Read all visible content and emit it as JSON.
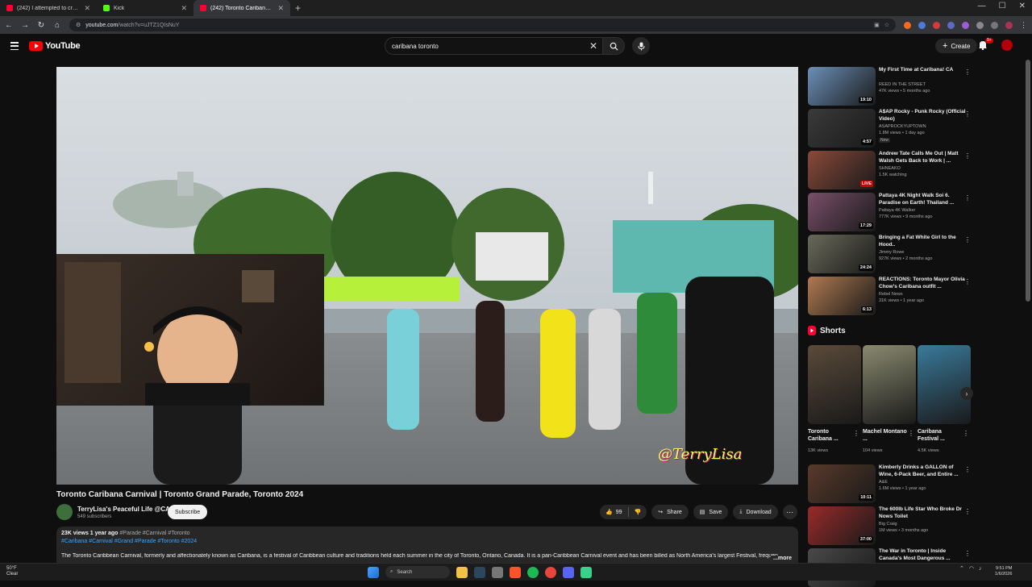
{
  "browser": {
    "tabs": [
      {
        "label": "(242) I attempted to cross Engl",
        "favicon_color": "#ff0033"
      },
      {
        "label": "Kick",
        "favicon_color": "#53fc18"
      },
      {
        "label": "(242) Toronto Caribana Carniv",
        "favicon_color": "#ff0033",
        "active": true
      }
    ],
    "url_host": "youtube.com",
    "url_path": "/watch?v=uJTZ1QIsNuY"
  },
  "masthead": {
    "logo_text": "YouTube",
    "search_value": "caribana toronto",
    "create_label": "Create",
    "notif_count": "9+"
  },
  "video": {
    "watermark": "@TerryLisa",
    "title": "Toronto Caribana Carnival | Toronto Grand Parade, Toronto 2024",
    "channel": "TerryLisa's Peaceful Life @CA",
    "subscribers": "549 subscribers",
    "subscribe_label": "Subscribe",
    "likes": "99",
    "share_label": "Share",
    "save_label": "Save",
    "download_label": "Download",
    "views_date": "23K views  1 year ago",
    "header_tags": "#Parade #Carnival #Toronto",
    "tags_line": "#Caribana #Carnival #Grand #Parade #Toronto #2024",
    "description": "The Toronto Caribbean Carnival, formerly and affectionately known as Caribana, is a festival of Caribbean culture and traditions held each summer in the city of Toronto, Ontario, Canada. It is a pan-Caribbean Carnival event and has been billed as North America's largest Festival, frequen",
    "more_label": "...more"
  },
  "recommendations": [
    {
      "title": "My First Time at Caribana! CA",
      "channel": "REED IN THE STREET",
      "meta": "47K views • 5 months ago",
      "duration": "19:10",
      "color": "#6c8fb8"
    },
    {
      "title": "A$AP Rocky - Punk Rocky (Official Video)",
      "channel": "ASAPROCKYUPTOWN",
      "meta": "1.8M views • 1 day ago",
      "badge": "New",
      "duration": "4:57",
      "color": "#3a3a3a"
    },
    {
      "title": "Andrew Tate Calls Me Out | Matt Walsh Gets Back to Work | ...",
      "channel": "SHNEAKO",
      "meta": "1.5K watching",
      "duration": "LIVE",
      "color": "#8a4a3a"
    },
    {
      "title": "Pattaya 4K Night Walk Soi 6. Paradise on Earth! Thailand ...",
      "channel": "Pattaya 4K Walker",
      "meta": "777K views • 9 months ago",
      "duration": "17:29",
      "color": "#7a4f6a"
    },
    {
      "title": "Bringing a Fat White Girl to the Hood..",
      "channel": "Jimmy Rowe",
      "meta": "927K views • 2 months ago",
      "duration": "24:24",
      "color": "#6a6a5a"
    },
    {
      "title": "REACTIONS: Toronto Mayor Olivia Chow's Caribana outfit ...",
      "channel": "Rebel News",
      "meta": "31K views • 1 year ago",
      "duration": "6:13",
      "color": "#b07a50"
    },
    {
      "title": "Kimberly Drinks a GALLON of Wine, 6-Pack Beer, and Entire ...",
      "channel": "A&E",
      "meta": "1.6M views • 1 year ago",
      "duration": "10:11",
      "color": "#5a3a2a"
    },
    {
      "title": "The 600lb Life Star Who Broke Dr Nows Toilet",
      "channel": "Big Craig",
      "meta": "1M views • 3 months ago",
      "duration": "37:00",
      "color": "#9a2a2a"
    },
    {
      "title": "The War in Toronto | Inside Canada's Most Dangerous ...",
      "channel": "",
      "meta": "",
      "duration": "",
      "color": "#4a4a4a"
    }
  ],
  "shorts": {
    "heading": "Shorts",
    "items": [
      {
        "title": "Toronto Caribana ...",
        "views": "13K views",
        "color": "#5a4a3a"
      },
      {
        "title": "Machel Montano ...",
        "views": "104 views",
        "color": "#8a8a70"
      },
      {
        "title": "Caribana Festival ...",
        "views": "4.5K views",
        "color": "#3a7a9a"
      }
    ]
  },
  "taskbar": {
    "temp": "50°F",
    "weather": "Clear",
    "search_label": "Search",
    "time": "9:51 PM",
    "date": "1/6/2026"
  }
}
